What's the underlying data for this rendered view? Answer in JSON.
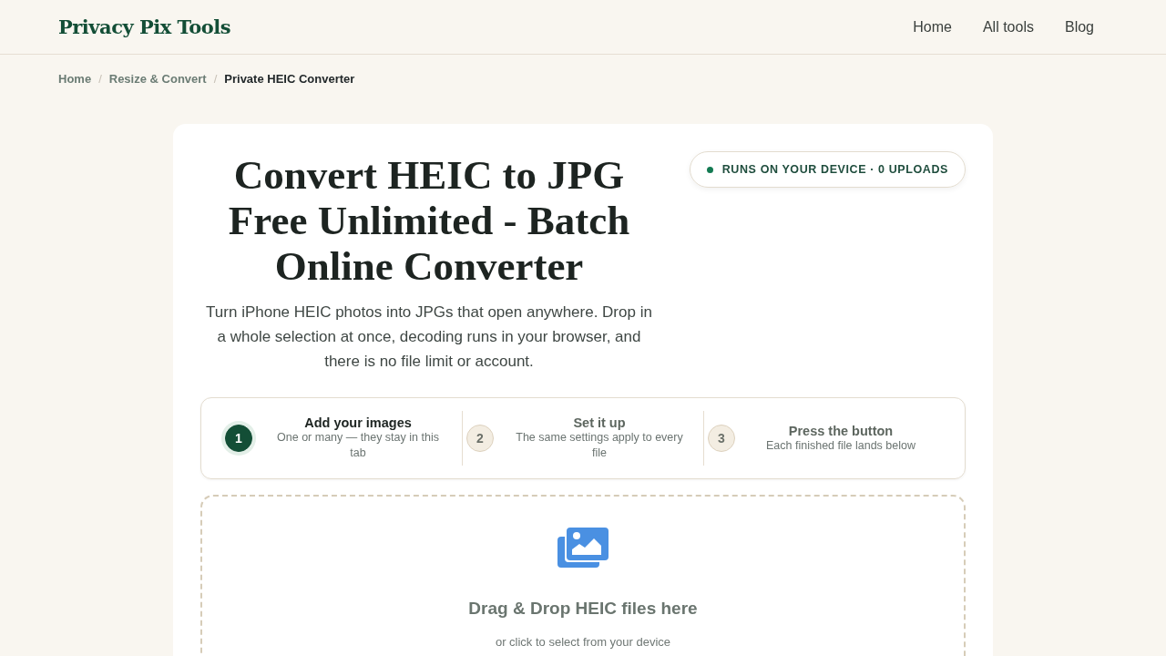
{
  "header": {
    "logo": "Privacy Pix Tools",
    "nav": [
      "Home",
      "All tools",
      "Blog"
    ]
  },
  "breadcrumb_separator": "/",
  "breadcrumb": [
    {
      "label": "Home",
      "current": false
    },
    {
      "label": "Resize & Convert",
      "current": false
    },
    {
      "label": "Private HEIC Converter",
      "current": true
    }
  ],
  "hero": {
    "title": "Convert HEIC to JPG Free Unlimited - Batch Online Converter",
    "description": "Turn iPhone HEIC photos into JPGs that open anywhere. Drop in a whole selection at once, decoding runs in your browser, and there is no file limit or account.",
    "badge": {
      "text": "RUNS ON YOUR DEVICE · 0 UPLOADS",
      "color": "#137a52"
    }
  },
  "steps": [
    {
      "number": "1",
      "title": "Add your images",
      "detail": "One or many — they stay in this tab",
      "selected": true
    },
    {
      "number": "2",
      "title": "Set it up",
      "detail": "The same settings apply to every file",
      "selected": false
    },
    {
      "number": "3",
      "title": "Press the button",
      "detail": "Each finished file lands below",
      "selected": false
    }
  ],
  "dropzone": {
    "title": "Drag & Drop HEIC files here",
    "hint": "or click to select from your device"
  }
}
